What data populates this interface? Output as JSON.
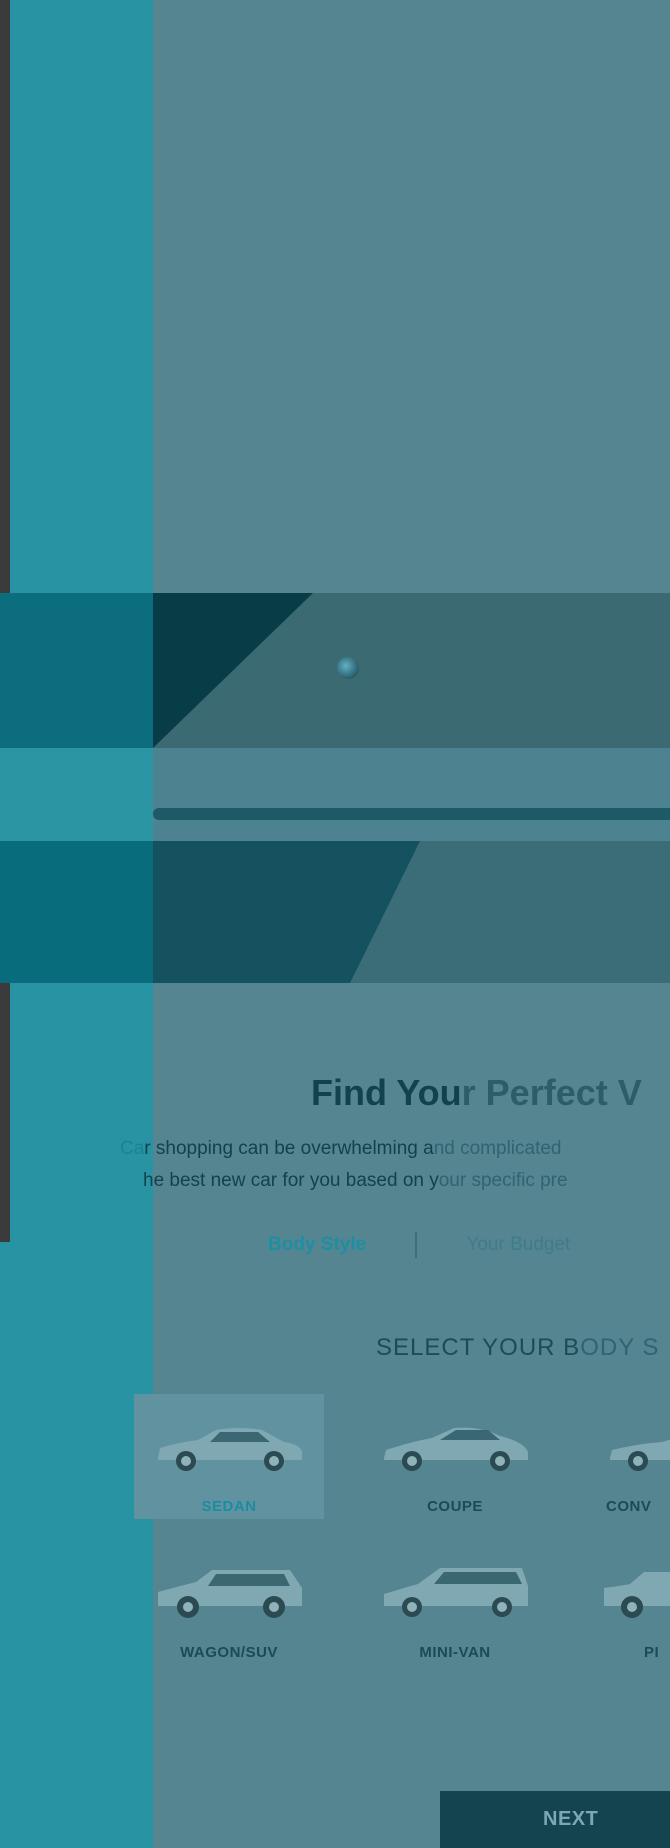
{
  "hero": {
    "image_icon": "car-hero-image"
  },
  "intro": {
    "title_strong": "Find You",
    "title_faded": "r Perfect V",
    "desc_line1_dim": "Ca",
    "desc_line1_strong": "r shopping can be overwhelming a",
    "desc_line1_faded": "nd complicated",
    "desc_line2_strong": "he best new car for you based on y",
    "desc_line2_faded": "our specific pre"
  },
  "steps": [
    {
      "label": "Body Style",
      "active": true
    },
    {
      "label": "Your Budget",
      "active": false
    }
  ],
  "select_heading": {
    "strong": "SELECT YOUR B",
    "faded": "ODY S"
  },
  "body_styles": [
    {
      "label": "SEDAN",
      "selected": true,
      "icon": "sedan-icon"
    },
    {
      "label": "COUPE",
      "selected": false,
      "icon": "coupe-icon"
    },
    {
      "label": "CONV",
      "selected": false,
      "icon": "convertible-icon"
    },
    {
      "label": "WAGON/SUV",
      "selected": false,
      "icon": "suv-icon"
    },
    {
      "label": "MINI-VAN",
      "selected": false,
      "icon": "minivan-icon"
    },
    {
      "label": "PI",
      "selected": false,
      "icon": "pickup-icon"
    }
  ],
  "next_button": "NEXT",
  "colors": {
    "accent": "#1e8ea2",
    "overlay": "#558590",
    "left_panel": "#2893a3",
    "button": "#14444f"
  }
}
